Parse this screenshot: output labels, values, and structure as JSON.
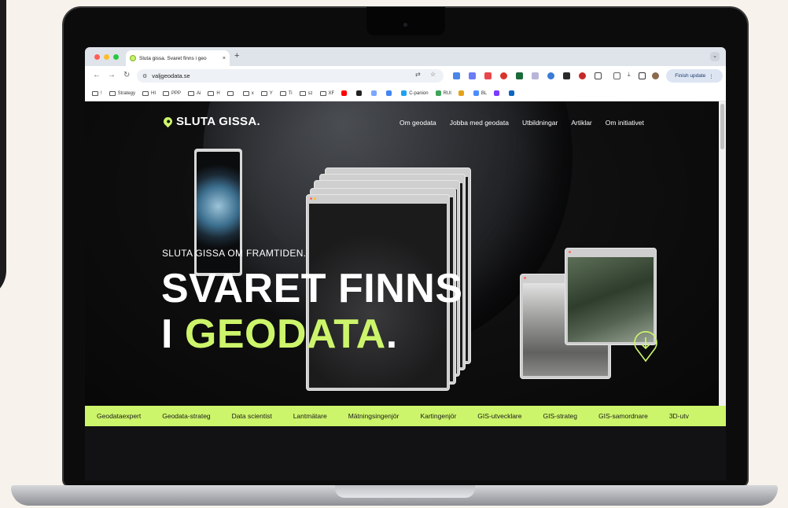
{
  "browser": {
    "tab": {
      "title": "Sluta gissa. Svaret finns i geo",
      "close": "×"
    },
    "new_tab": "+",
    "tab_menu": "⌄",
    "url": "valjgeodata.se",
    "finish_update": "Finish update",
    "bookmarks": [
      {
        "label": "!",
        "type": "folder"
      },
      {
        "label": "Strategy",
        "type": "folder"
      },
      {
        "label": "HI",
        "type": "folder"
      },
      {
        "label": "PPP",
        "type": "folder"
      },
      {
        "label": "Ai",
        "type": "folder"
      },
      {
        "label": "H",
        "type": "folder"
      },
      {
        "label": "",
        "type": "folder"
      },
      {
        "label": "x",
        "type": "folder"
      },
      {
        "label": "Y",
        "type": "folder"
      },
      {
        "label": "Ti",
        "type": "folder"
      },
      {
        "label": "sz",
        "type": "folder"
      },
      {
        "label": "XF",
        "type": "folder"
      },
      {
        "label": "",
        "type": "site",
        "color": "#ff0000"
      },
      {
        "label": "",
        "type": "site",
        "color": "#222222"
      },
      {
        "label": "",
        "type": "site",
        "color": "#7aa7ff"
      },
      {
        "label": "",
        "type": "site",
        "color": "#4285f4"
      },
      {
        "label": "C-panion",
        "type": "site",
        "color": "#1da1f2"
      },
      {
        "label": "RUI",
        "type": "site",
        "color": "#3ea55b"
      },
      {
        "label": "",
        "type": "site",
        "color": "#e3a21a"
      },
      {
        "label": "BL",
        "type": "site",
        "color": "#4b8cff"
      },
      {
        "label": "",
        "type": "site",
        "color": "#7a3cff"
      },
      {
        "label": "",
        "type": "site",
        "color": "#0a66c2"
      }
    ]
  },
  "site": {
    "logo": "SLUTA GISSA.",
    "nav": [
      "Om geodata",
      "Jobba med geodata",
      "Utbildningar",
      "Artiklar",
      "Om initiativet"
    ],
    "hero": {
      "eyebrow": "SLUTA GISSA OM FRAMTIDEN.",
      "line1": "SVARET FINNS",
      "line2_prefix": "I ",
      "line2_accent": "GEODATA",
      "line2_suffix": "."
    },
    "ticker": [
      "Geodataexpert",
      "Geodata-strateg",
      "Data scientist",
      "Lantmätare",
      "Mätningsingenjör",
      "Kartingenjör",
      "GIS-utvecklare",
      "GIS-strateg",
      "GIS-samordnare",
      "3D-utv"
    ]
  },
  "colors": {
    "accent": "#cdf56b",
    "page_bg": "#111112"
  }
}
